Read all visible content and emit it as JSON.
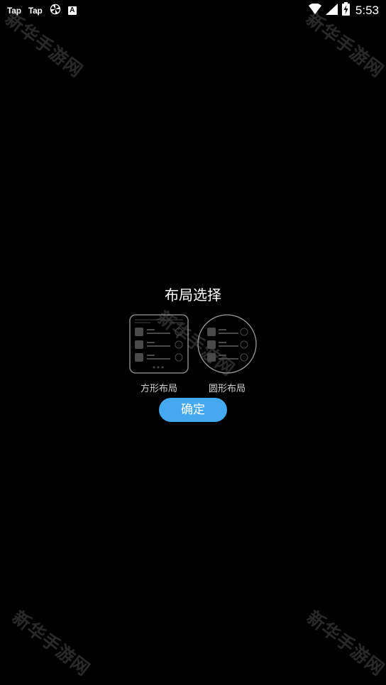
{
  "status_bar": {
    "app_icons": [
      "Tap",
      "Tap"
    ],
    "a_icon_text": "A",
    "time": "5:53"
  },
  "dialog": {
    "title": "布局选择",
    "options": [
      {
        "label": "方形布局",
        "shape": "square"
      },
      {
        "label": "圆形布局",
        "shape": "round"
      }
    ],
    "confirm_label": "确定"
  },
  "watermark": "新华手游网",
  "colors": {
    "background": "#000000",
    "accent": "#45a9f0"
  }
}
